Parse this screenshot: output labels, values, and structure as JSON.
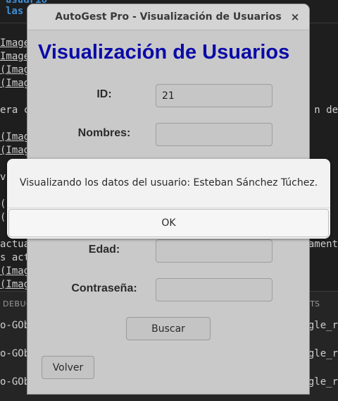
{
  "background": {
    "top_lines": [
      "usuario",
      "las"
    ],
    "left_fragments": [
      "Image",
      "Image",
      "(Imag",
      "(Imag",
      "era c",
      "(Imag",
      "(Imag",
      "v",
      "(",
      "(",
      "actua",
      "s act",
      "(Imag",
      "(Imag"
    ],
    "right_fragments": [
      "n de",
      "ament"
    ],
    "debug_label": "DEBUG",
    "nts_label": "NTS",
    "bottom_lines": [
      "o-GObj",
      "o-GObj",
      "o-GObj"
    ],
    "bottom_right": [
      "ggle_r",
      "ggle_r",
      "ggle_r"
    ]
  },
  "window": {
    "title": "AutoGest Pro - Visualización de Usuarios",
    "close_glyph": "×",
    "heading": "Visualización de Usuarios",
    "fields": [
      {
        "label": "ID:",
        "value": "21"
      },
      {
        "label": "Nombres:",
        "value": ""
      },
      {
        "label": "Edad:",
        "value": ""
      },
      {
        "label": "Contraseña:",
        "value": ""
      }
    ],
    "search_button": "Buscar",
    "back_button": "Volver"
  },
  "dialog": {
    "message": "Visualizando los datos del usuario: Esteban Sánchez Túchez.",
    "ok_button": "OK"
  }
}
